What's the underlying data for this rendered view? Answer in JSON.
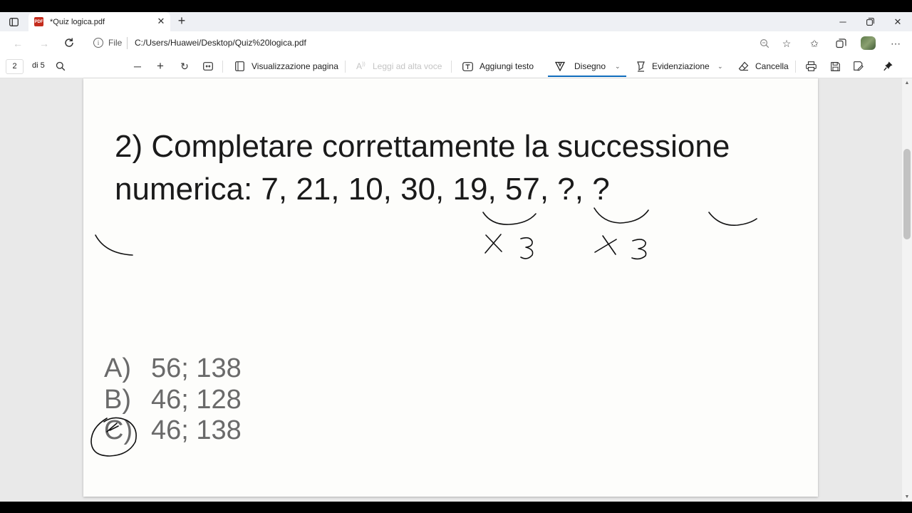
{
  "browser": {
    "tab": {
      "title": "*Quiz logica.pdf",
      "badge": "PDF"
    },
    "address": {
      "file_label": "File",
      "url": "C:/Users/Huawei/Desktop/Quiz%20logica.pdf"
    }
  },
  "pdf_toolbar": {
    "page_current": "2",
    "page_total": "di 5",
    "page_view_label": "Visualizzazione pagina",
    "read_aloud_label": "Leggi ad alta voce",
    "add_text_label": "Aggiungi testo",
    "draw_label": "Disegno",
    "highlight_label": "Evidenziazione",
    "erase_label": "Cancella"
  },
  "document": {
    "question": "2)  Completare correttamente la successione numerica: 7, 21, 10, 30, 19, 57, ?, ?",
    "answers": [
      {
        "letter": "A)",
        "value": "56; 138"
      },
      {
        "letter": "B)",
        "value": "46; 128"
      },
      {
        "letter": "C)",
        "value": "46; 138"
      }
    ]
  },
  "annotations": {
    "ink_color": "#111111",
    "handwritten": [
      "X 3",
      "X 3"
    ],
    "selected_answer": "C)"
  },
  "colors": {
    "accent": "#0f6cbd",
    "pdf_badge": "#c42b1c"
  }
}
